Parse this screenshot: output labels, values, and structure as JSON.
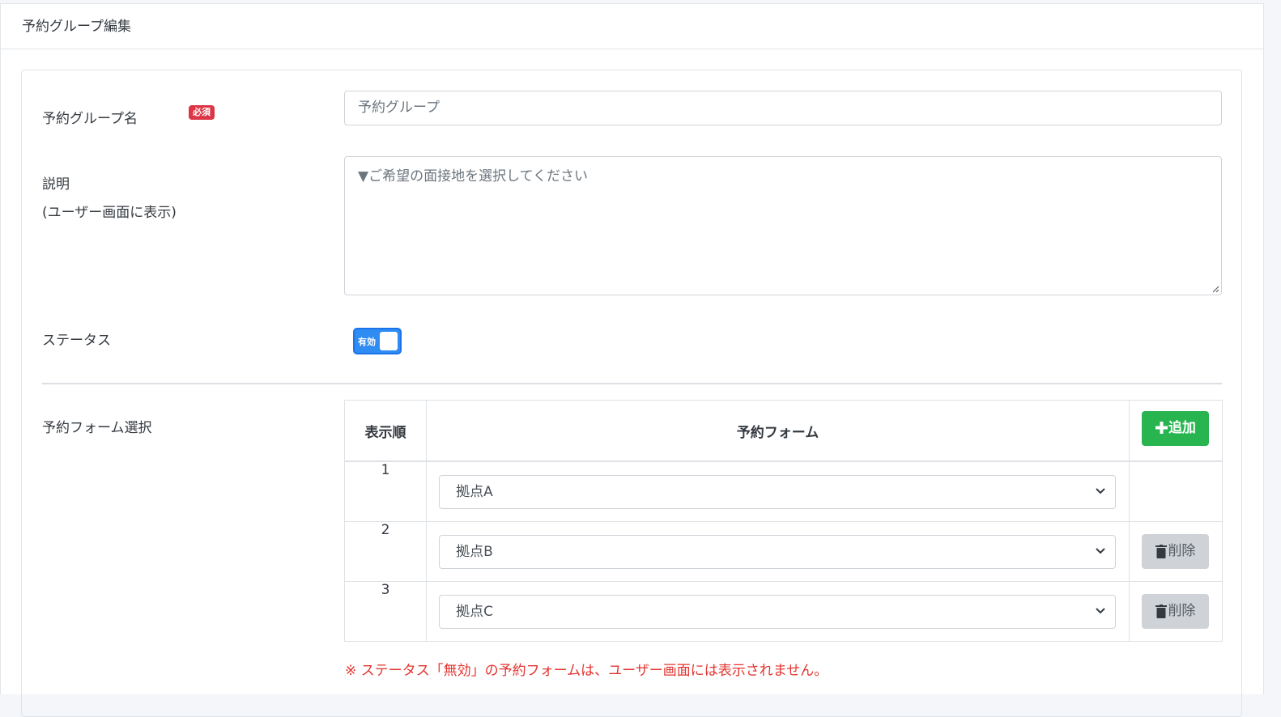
{
  "header": {
    "title": "予約グループ編集"
  },
  "form": {
    "group_name_label": "予約グループ名",
    "required_badge": "必須",
    "group_name_value": "予約グループ",
    "description_label": "説明",
    "description_sublabel": "(ユーザー画面に表示)",
    "description_value": "▼ご希望の面接地を選択してください",
    "status_label": "ステータス",
    "status_toggle_text": "有効",
    "status_on": true,
    "form_select_label": "予約フォーム選択"
  },
  "table": {
    "headers": {
      "order": "表示順",
      "form": "予約フォーム",
      "add_button": "追加"
    },
    "rows": [
      {
        "order": "1",
        "selected": "拠点A",
        "delete_label": ""
      },
      {
        "order": "2",
        "selected": "拠点B",
        "delete_label": "削除"
      },
      {
        "order": "3",
        "selected": "拠点C",
        "delete_label": "削除"
      }
    ]
  },
  "note": "※ ステータス「無効」の予約フォームは、ユーザー画面には表示されません。",
  "colors": {
    "accent_blue": "#2f8cf3",
    "add_green": "#28b54f",
    "required_red": "#dc3545",
    "note_red": "#e3342f",
    "delete_gray": "#cfd3d8"
  },
  "icons": {
    "add": "plus-icon",
    "delete": "trash-icon",
    "select": "chevron-down-icon"
  }
}
